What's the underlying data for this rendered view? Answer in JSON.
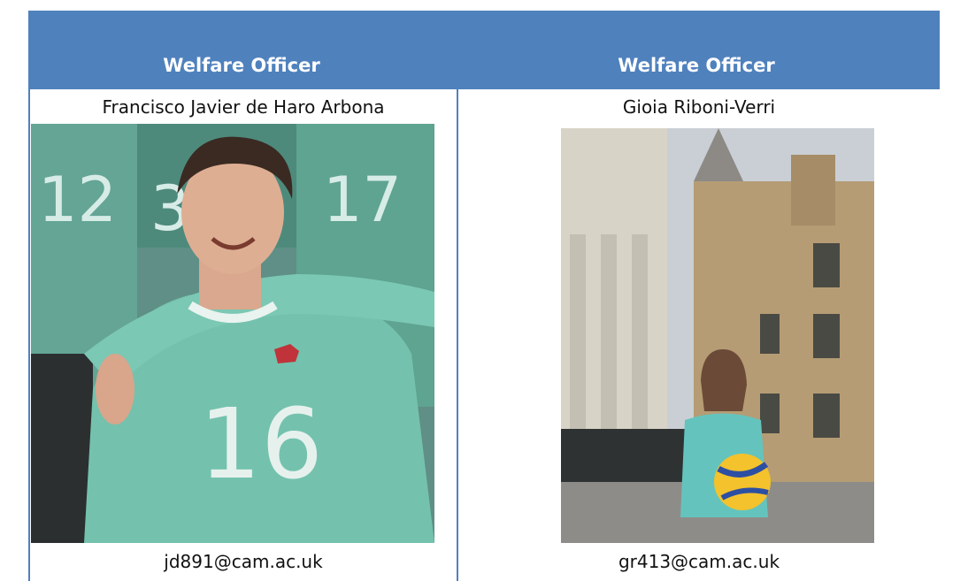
{
  "columns": [
    {
      "role": "Welfare Officer",
      "name": "Francisco Javier de Haro Arbona",
      "email": "jd891@cam.ac.uk",
      "photo": {
        "jersey_numbers": [
          "12",
          "3",
          "17",
          "16"
        ],
        "jersey_color": "#6fb7a5"
      }
    },
    {
      "role": "Welfare Officer",
      "name": "Gioia Riboni-Verri",
      "email": "gr413@cam.ac.uk",
      "photo": {
        "jersey_color": "#5fc0b9",
        "ball_color": "#f3c22c"
      }
    }
  ],
  "colors": {
    "header_bg": "#4f81bd",
    "header_text": "#ffffff",
    "border": "#4f81bd"
  }
}
